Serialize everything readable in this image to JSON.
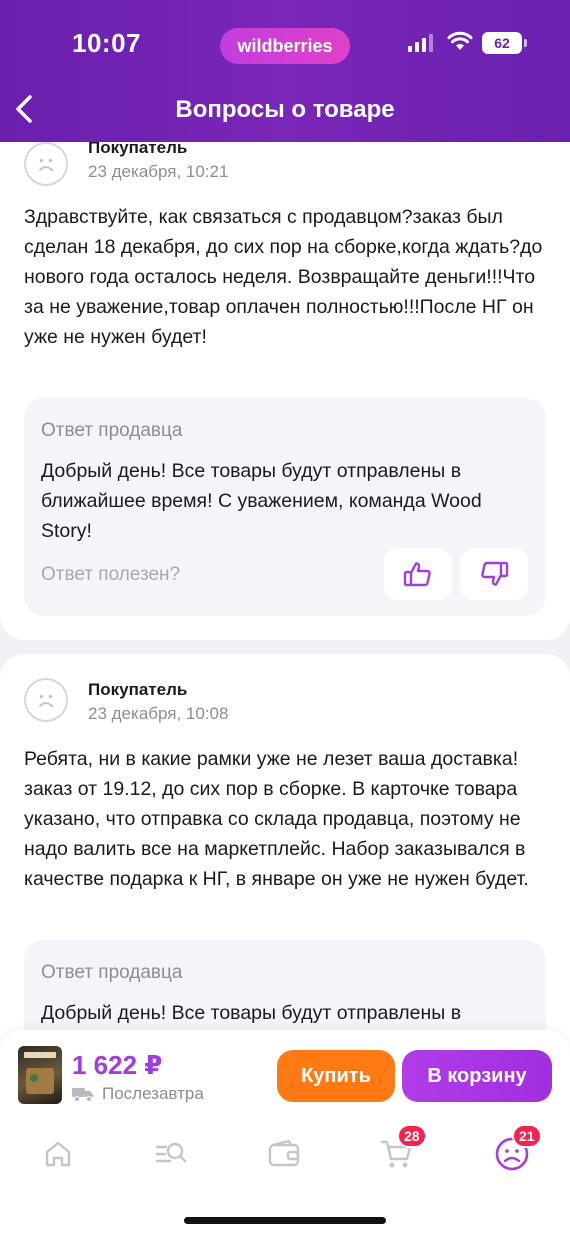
{
  "status_bar": {
    "time": "10:07",
    "app_badge": "wildberries",
    "battery": "62"
  },
  "header": {
    "title": "Вопросы о товаре"
  },
  "questions": [
    {
      "author": "Покупатель",
      "date": "23 декабря, 10:21",
      "text": "Здравствуйте, как связаться с продавцом?заказ был сделан 18 декабря, до сих пор на сборке,когда ждать?до нового года осталось неделя. Возвращайте деньги!!!Что за не уважение,товар оплачен полностью!!!После НГ он уже не нужен будет!",
      "answer": {
        "label": "Ответ продавца",
        "text": "Добрый день! Все товары будут отправлены в ближайшее время!  С уважением, команда Wood Story!",
        "helpful_label": "Ответ полезен?"
      }
    },
    {
      "author": "Покупатель",
      "date": "23 декабря, 10:08",
      "text": "Ребята, ни в какие рамки уже не лезет ваша доставка! заказ от 19.12, до сих пор в сборке. В карточке товара указано, что отправка со склада продавца, поэтому не надо валить все на маркетплейс. Набор заказывался в качестве подарка к НГ, в январе он уже не нужен будет.",
      "answer": {
        "label": "Ответ продавца",
        "text": "Добрый день! Все товары будут отправлены в"
      }
    }
  ],
  "purchase_bar": {
    "price": "1 622 ₽",
    "delivery": "Послезавтра",
    "buy_label": "Купить",
    "cart_label": "В корзину"
  },
  "bottom_nav": {
    "items": [
      {
        "icon": "home-icon"
      },
      {
        "icon": "catalog-search-icon"
      },
      {
        "icon": "wallet-icon"
      },
      {
        "icon": "cart-icon",
        "badge": "28"
      },
      {
        "icon": "profile-icon",
        "badge": "21"
      }
    ]
  },
  "colors": {
    "header": "#6a20b0",
    "accent": "#a13de0",
    "buy": "#ff7a14",
    "badge": "#f5234d"
  }
}
